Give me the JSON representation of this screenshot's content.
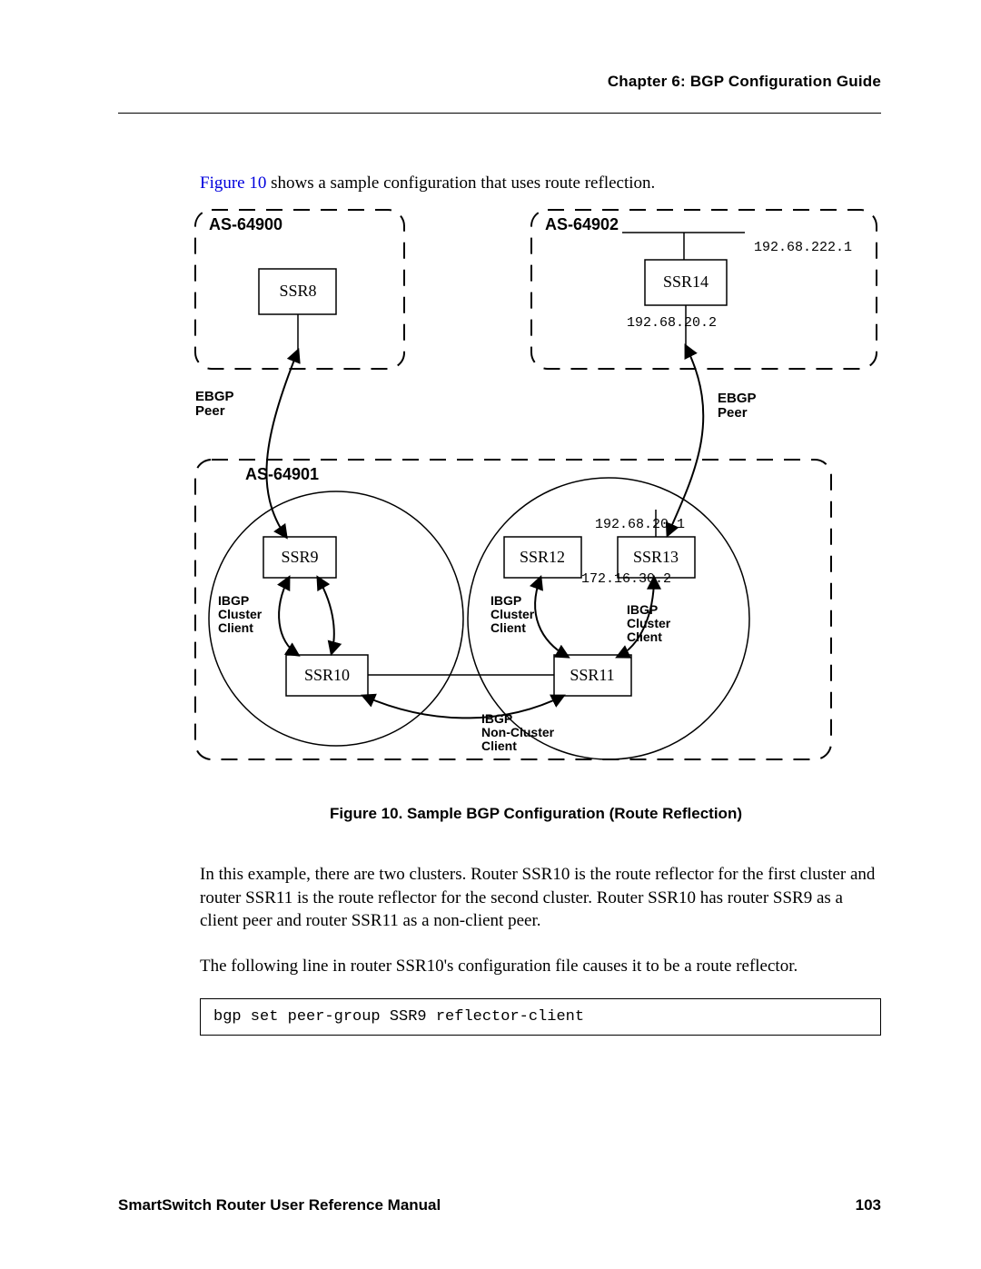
{
  "header": {
    "chapter": "Chapter 6: BGP Configuration Guide"
  },
  "intro": {
    "link": "Figure 10",
    "rest": " shows a sample configuration that uses route reflection."
  },
  "diagram": {
    "as_left": "AS-64900",
    "as_right": "AS-64902",
    "as_bottom": "AS-64901",
    "ssr8": "SSR8",
    "ssr9": "SSR9",
    "ssr10": "SSR10",
    "ssr11": "SSR11",
    "ssr12": "SSR12",
    "ssr13": "SSR13",
    "ssr14": "SSR14",
    "ip1": "192.68.222.1",
    "ip2": "192.68.20.2",
    "ip3": "192.68.20.1",
    "ip4": "172.16.30.2",
    "ebgp_left": "EBGP\nPeer",
    "ebgp_right": "EBGP\nPeer",
    "ibgp1": "IBGP\nCluster\nClient",
    "ibgp2": "IBGP\nCluster\nClient",
    "ibgp3": "IBGP\nCluster\nClient",
    "ibgp_nc": "IBGP\nNon-Cluster\nClient"
  },
  "caption": "Figure 10.  Sample BGP Configuration (Route Reflection)",
  "para1": "In this example, there are two clusters. Router SSR10 is the route reflector for the first cluster and router SSR11 is the route reflector for the second cluster. Router SSR10 has router SSR9 as a client peer and router SSR11 as a non-client peer.",
  "para2": "The following line in router SSR10's configuration file causes it to be a route reflector.",
  "code": "bgp set peer-group SSR9 reflector-client",
  "footer": {
    "left": "SmartSwitch Router User Reference Manual",
    "right": "103"
  }
}
